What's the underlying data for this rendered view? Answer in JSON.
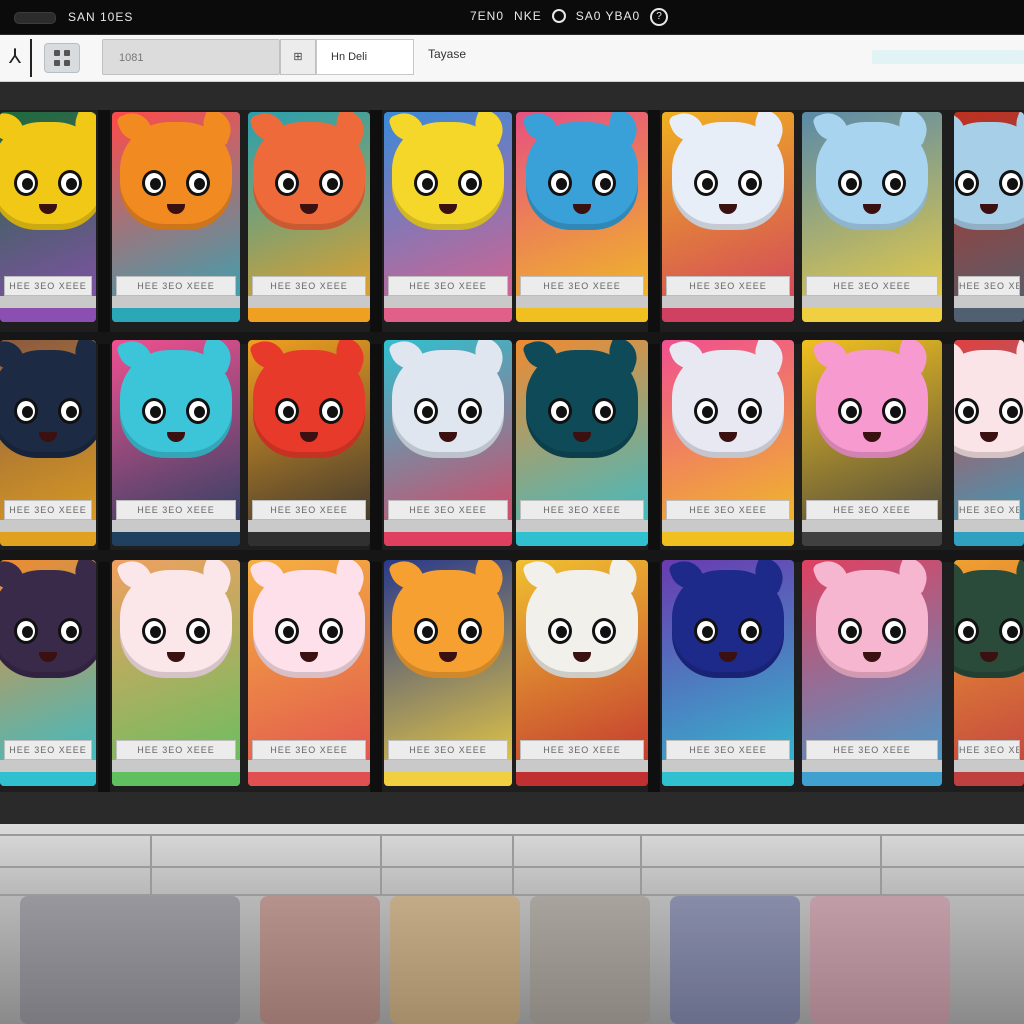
{
  "topbar": {
    "app_label": "SAN 10ES",
    "status_a": "7EN0",
    "status_b": "NKE",
    "status_c": "SA0 YBA0",
    "help_glyph": "?"
  },
  "toolbar": {
    "back_glyph": "⅄",
    "search_value": "1081",
    "field_icon_text": "⊞",
    "filter_value": "Hn Deli",
    "tag_value": "Tayase"
  },
  "icons": [
    "back-icon",
    "grid-icon",
    "field-icon",
    "dot-icon",
    "help-icon"
  ],
  "shelf": {
    "label_text": "HEE 3EO XEEE"
  }
}
